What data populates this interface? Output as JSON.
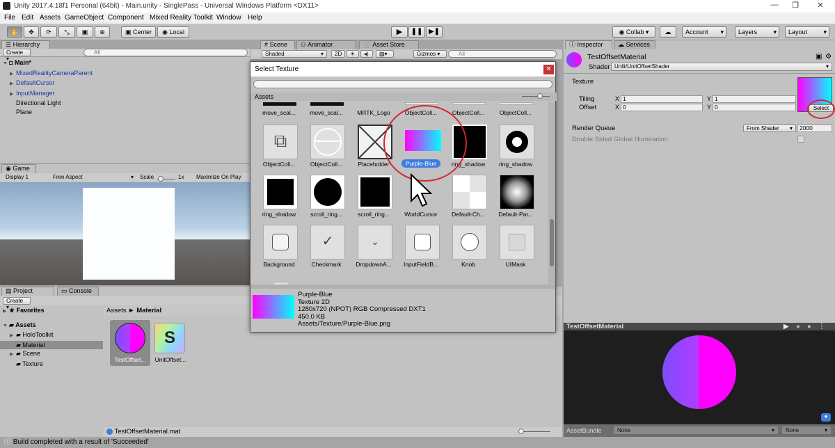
{
  "window": {
    "title": "Unity 2017.4.18f1 Personal (64bit) - Main.unity - SinglePass - Universal Windows Platform <DX11>",
    "min": "—",
    "restore": "❐",
    "close": "✕"
  },
  "menu": [
    "File",
    "Edit",
    "Assets",
    "GameObject",
    "Component",
    "Mixed Reality Toolkit",
    "Window",
    "Help"
  ],
  "toolbar": {
    "pivot_center": "Center",
    "pivot_local": "Local",
    "collab": "Collab",
    "account": "Account",
    "layers": "Layers",
    "layout": "Layout"
  },
  "hierarchy": {
    "tab": "Hierarchy",
    "create": "Create",
    "search": "All",
    "scene": "Main*",
    "items": [
      "MixedRealityCameraParent",
      "DefaultCursor",
      "InputManager",
      "Directional Light",
      "Plane"
    ]
  },
  "scene": {
    "tab": "Scene",
    "animator_tab": "Animator",
    "asset_store_tab": "Asset Store",
    "shading": "Shaded",
    "mode2d": "2D",
    "gizmos": "Gizmos",
    "search": "All"
  },
  "game": {
    "tab": "Game",
    "display": "Display 1",
    "aspect": "Free Aspect",
    "scale_label": "Scale",
    "scale_value": "1x",
    "maximize": "Maximize On Play"
  },
  "project": {
    "tab": "Project",
    "console_tab": "Console",
    "create": "Create",
    "favorites": "Favorites",
    "assets": "Assets",
    "folders": [
      "HoloToolkit",
      "Material",
      "Scene",
      "Texture"
    ],
    "breadcrumb_root": "Assets",
    "breadcrumb_sep": "►",
    "breadcrumb_leaf": "Material",
    "files": [
      "TestOffset...",
      "UnitOffset..."
    ],
    "selected_path": "TestOffsetMaterial.mat"
  },
  "dialog": {
    "title": "Select Texture",
    "section": "Assets",
    "row0": [
      "move_scal...",
      "move_scal...",
      "MRTK_Logo",
      "ObjectColl...",
      "ObjectColl...",
      "ObjectColl..."
    ],
    "row1": [
      "ObjectColl...",
      "ObjectColl...",
      "Placeholder",
      "Purple-Blue",
      "ring_shadow",
      "ring_shadow"
    ],
    "row2": [
      "ring_shadow",
      "scroll_ring...",
      "scroll_ring...",
      "WorldCursor",
      "Default-Ch...",
      "Default-Par..."
    ],
    "row3": [
      "Background",
      "Checkmark",
      "DropdownA...",
      "InputFieldB...",
      "Knob",
      "UIMask"
    ],
    "info": {
      "name": "Purple-Blue",
      "type": "Texture 2D",
      "format": "1280x720 (NPOT)  RGB Compressed DXT1",
      "size": "450.0 KB",
      "path": "Assets/Texture/Purple-Blue.png"
    }
  },
  "inspector": {
    "tab": "Inspector",
    "services_tab": "Services",
    "material_name": "TestOffsetMaterial",
    "shader_label": "Shader",
    "shader_value": "Unlit/UnitOffsetShader",
    "texture_label": "Texture",
    "tiling_label": "Tiling",
    "offset_label": "Offset",
    "x_label": "X",
    "y_label": "Y",
    "tiling_x": "1",
    "tiling_y": "1",
    "offset_x": "0",
    "offset_y": "0",
    "select_button": "Select",
    "render_queue_label": "Render Queue",
    "render_queue_mode": "From Shader",
    "render_queue_value": "2000",
    "double_sided": "Double Sided Global Illumination",
    "preview_title": "TestOffsetMaterial",
    "assetbundle_label": "AssetBundle",
    "assetbundle_value": "None",
    "assetbundle_variant": "None"
  },
  "status": "Build completed with a result of 'Succeeded'",
  "colors": {
    "gradient_start": "#ff00ff",
    "gradient_end": "#00ffff",
    "highlight_ring": "#d0282d",
    "selection_blue": "#3e7ce0"
  }
}
